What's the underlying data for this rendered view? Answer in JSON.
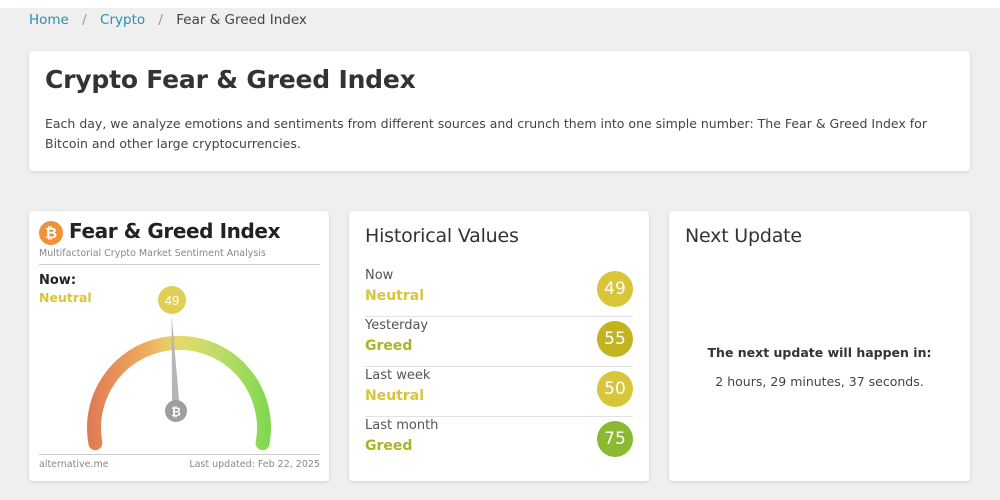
{
  "breadcrumb": {
    "home": "Home",
    "section": "Crypto",
    "current": "Fear & Greed Index"
  },
  "intro": {
    "title": "Crypto Fear & Greed Index",
    "description": "Each day, we analyze emotions and sentiments from different sources and crunch them into one simple number: The Fear & Greed Index for Bitcoin and other large cryptocurrencies."
  },
  "widget": {
    "coin_symbol": "₿",
    "title": "Fear & Greed Index",
    "subtitle": "Multifactorial Crypto Market Sentiment Analysis",
    "now_label": "Now:",
    "now_state": "Neutral",
    "value": "49",
    "value_num": 49,
    "source": "alternative.me",
    "last_updated": "Last updated: Feb 22, 2025",
    "icons": {
      "coin": "bitcoin-icon",
      "needle": "gauge-needle"
    }
  },
  "historical": {
    "title": "Historical Values",
    "rows": [
      {
        "label": "Now",
        "state": "Neutral",
        "value": "49",
        "color": "#d9c53a"
      },
      {
        "label": "Yesterday",
        "state": "Greed",
        "value": "55",
        "color": "#c2b41f"
      },
      {
        "label": "Last week",
        "state": "Neutral",
        "value": "50",
        "color": "#d9c53a"
      },
      {
        "label": "Last month",
        "state": "Greed",
        "value": "75",
        "color": "#8cb832"
      }
    ],
    "state_colors": {
      "Neutral": "#d9c53a",
      "Greed": "#aab422"
    }
  },
  "next_update": {
    "title": "Next Update",
    "heading": "The next update will happen in:",
    "countdown": "2 hours, 29 minutes, 37 seconds."
  }
}
